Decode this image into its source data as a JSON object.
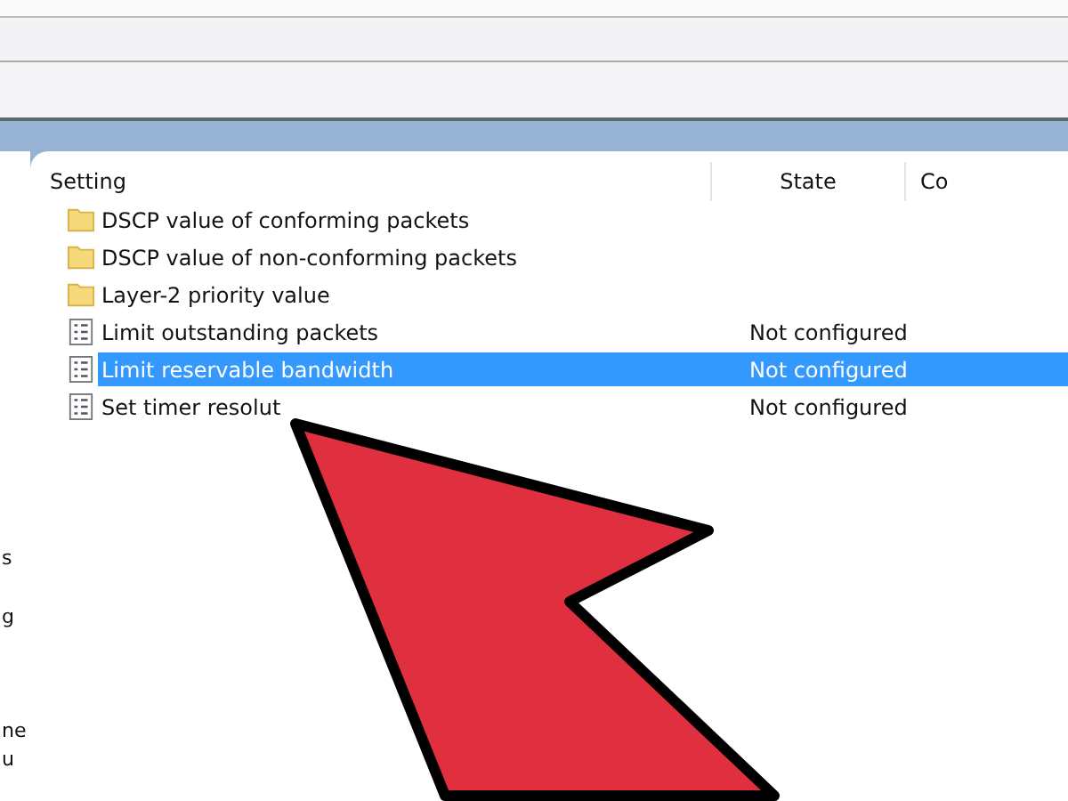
{
  "left_pane": {
    "fragments": [
      "s",
      "g",
      "ne",
      "u"
    ]
  },
  "table": {
    "columns": [
      "Setting",
      "State",
      "Co"
    ],
    "rows": [
      {
        "kind": "folder",
        "setting": "DSCP value of conforming packets",
        "state": "",
        "selected": false
      },
      {
        "kind": "folder",
        "setting": "DSCP value of non-conforming packets",
        "state": "",
        "selected": false
      },
      {
        "kind": "folder",
        "setting": "Layer-2 priority value",
        "state": "",
        "selected": false
      },
      {
        "kind": "policy",
        "setting": "Limit outstanding packets",
        "state": "Not configured",
        "selected": false
      },
      {
        "kind": "policy",
        "setting": "Limit reservable bandwidth",
        "state": "Not configured",
        "selected": true
      },
      {
        "kind": "policy",
        "setting": "Set timer resolut",
        "state": "Not configured",
        "selected": false
      }
    ]
  }
}
